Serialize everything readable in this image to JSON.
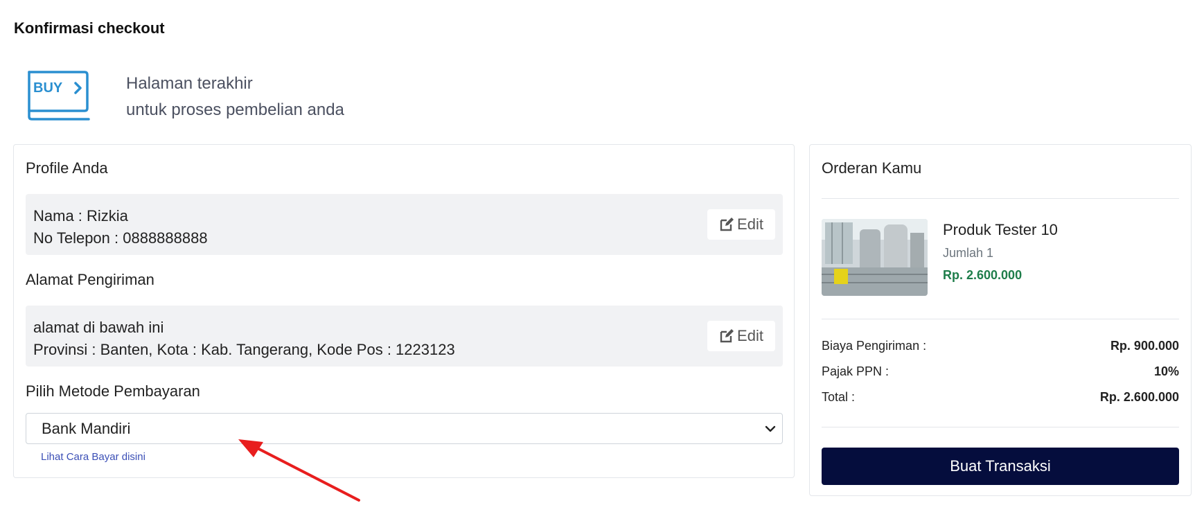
{
  "page_title": "Konfirmasi checkout",
  "hero": {
    "icon_text": "BUY",
    "line1": "Halaman terakhir",
    "line2": "untuk proses pembelian anda"
  },
  "profile": {
    "title": "Profile Anda",
    "name_line": "Nama : Rizkia",
    "phone_line": "No Telepon : 0888888888",
    "edit_label": "Edit"
  },
  "shipping": {
    "title": "Alamat Pengiriman",
    "address_line": "alamat di bawah ini",
    "region_line": "Provinsi : Banten, Kota : Kab. Tangerang, Kode Pos : 1223123",
    "edit_label": "Edit"
  },
  "payment": {
    "title": "Pilih Metode Pembayaran",
    "selected": "Bank Mandiri",
    "help_link": "Lihat Cara Bayar disini"
  },
  "order": {
    "title": "Orderan Kamu",
    "product_name": "Produk Tester 10",
    "product_qty": "Jumlah 1",
    "product_price": "Rp. 2.600.000",
    "shipping_label": "Biaya Pengiriman :",
    "shipping_value": "Rp. 900.000",
    "tax_label": "Pajak PPN :",
    "tax_value": "10%",
    "total_label": "Total :",
    "total_value": "Rp. 2.600.000",
    "cta_label": "Buat Transaksi"
  },
  "colors": {
    "accent_dark": "#050d3d",
    "price_green": "#1e7d4a",
    "link_blue": "#3b4fb6",
    "icon_blue": "#2a8fd0",
    "annotation_red": "#e81e1e"
  }
}
